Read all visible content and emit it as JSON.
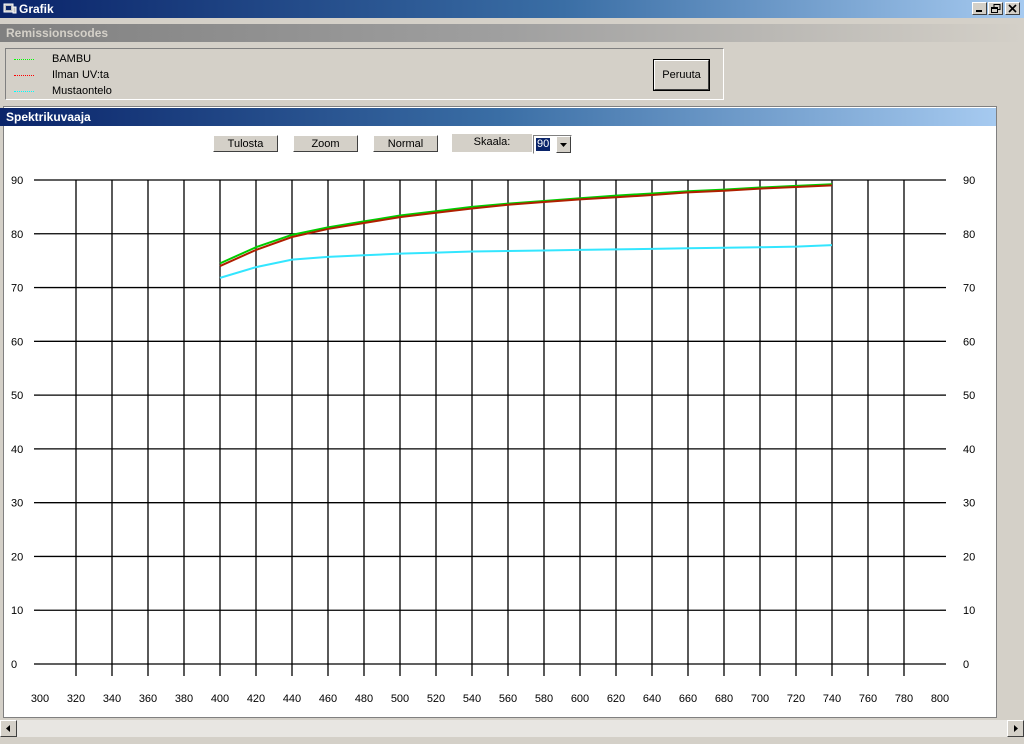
{
  "window": {
    "title": "Grafik",
    "controls": {
      "minimize": "minimize-icon",
      "restore": "restore-icon",
      "close": "close-icon"
    }
  },
  "legend_section": {
    "title": "Remissionscodes",
    "items": [
      {
        "label": "BAMBU",
        "color": "#00ff00"
      },
      {
        "label": "Ilman UV:ta",
        "color": "#ff0000"
      },
      {
        "label": "Mustaontelo",
        "color": "#00ffff"
      }
    ],
    "cancel_label": "Peruuta"
  },
  "graph_section": {
    "title": "Spektrikuvaaja",
    "toolbar": {
      "print_label": "Tulosta",
      "zoom_label": "Zoom",
      "normal_label": "Normal",
      "scale_label": "Skaala:",
      "scale_value": "90"
    }
  },
  "chart_data": {
    "type": "line",
    "xlim": [
      300,
      800
    ],
    "ylim": [
      0,
      90
    ],
    "x_ticks": [
      300,
      320,
      340,
      360,
      380,
      400,
      420,
      440,
      460,
      480,
      500,
      520,
      540,
      560,
      580,
      600,
      620,
      640,
      660,
      680,
      700,
      720,
      740,
      760,
      780,
      800
    ],
    "y_ticks": [
      0,
      10,
      20,
      30,
      40,
      50,
      60,
      70,
      80,
      90
    ],
    "grid": true,
    "series": [
      {
        "name": "BAMBU",
        "color": "#00cc00",
        "x": [
          400,
          420,
          440,
          460,
          480,
          500,
          520,
          540,
          560,
          580,
          600,
          620,
          640,
          660,
          680,
          700,
          720,
          740
        ],
        "y": [
          74.5,
          77.5,
          79.8,
          81.2,
          82.3,
          83.4,
          84.2,
          85.0,
          85.6,
          86.1,
          86.6,
          87.1,
          87.5,
          87.9,
          88.2,
          88.6,
          88.9,
          89.2
        ]
      },
      {
        "name": "Ilman UV:ta",
        "color": "#b02000",
        "x": [
          400,
          420,
          440,
          460,
          480,
          500,
          520,
          540,
          560,
          580,
          600,
          620,
          640,
          660,
          680,
          700,
          720,
          740
        ],
        "y": [
          74.0,
          77.0,
          79.4,
          80.9,
          82.0,
          83.1,
          83.9,
          84.7,
          85.4,
          85.9,
          86.4,
          86.8,
          87.2,
          87.7,
          88.0,
          88.4,
          88.7,
          89.0
        ]
      },
      {
        "name": "Mustaontelo",
        "color": "#33e6ff",
        "x": [
          400,
          420,
          440,
          460,
          480,
          500,
          520,
          540,
          560,
          580,
          600,
          620,
          640,
          660,
          680,
          700,
          720,
          740
        ],
        "y": [
          71.8,
          73.8,
          75.2,
          75.7,
          76.0,
          76.3,
          76.5,
          76.7,
          76.8,
          76.9,
          77.0,
          77.1,
          77.2,
          77.3,
          77.4,
          77.5,
          77.6,
          77.9
        ]
      }
    ]
  },
  "scrollbar": {
    "left_icon": "scroll-left-icon",
    "right_icon": "scroll-right-icon"
  }
}
